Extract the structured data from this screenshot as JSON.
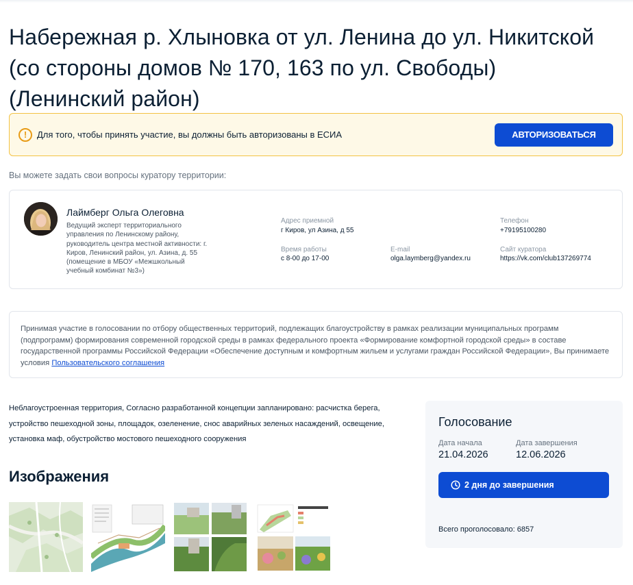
{
  "page": {
    "title": "Набережная р. Хлыновка от ул. Ленина до ул. Никитской (со стороны домов № 170, 163 по ул. Свободы) (Ленинский район)"
  },
  "alert": {
    "icon": "warning-icon",
    "text": "Для того, чтобы принять участие, вы должны быть авторизованы в ЕСИА",
    "button_label": "АВТОРИЗОВАТЬСЯ",
    "accent_color": "#f3c243",
    "button_color": "#0d4cd3"
  },
  "curator": {
    "intro": "Вы можете задать свои вопросы куратору территории:",
    "name": "Лаймберг Ольга Олеговна",
    "role": "Ведущий эксперт территориального управления по Ленинскому району, руководитель центра местной активности: г. Киров, Ленинский район, ул. Азина, д. 55 (помещение в МБОУ «Межшкольный учебный комбинат №3»)",
    "address_label": "Адрес приемной",
    "address": "г Киров, ул Азина, д 55",
    "hours_label": "Время работы",
    "hours": "с 8-00 до 17-00",
    "email_label": "E-mail",
    "email": "olga.laymberg@yandex.ru",
    "phone_label": "Телефон",
    "phone": "+79195100280",
    "site_label": "Сайт куратора",
    "site": "https://vk.com/club137269774"
  },
  "agreement": {
    "text": "Принимая участие в голосовании по отбору общественных территорий, подлежащих благоустройству в рамках реализации муниципальных программ (подпрограмм) формирования современной городской среды в рамках федерального проекта «Формирование комфортной городской среды» в составе государственной программы Российской Федерации «Обеспечение доступным и комфортным жильем и услугами граждан Российской Федерации», Вы принимаете условия",
    "link_label": "Пользовательского соглашения"
  },
  "description": "Неблагоустроенная территория, Согласно разработанной концепции запланировано: расчистка берега, устройство пешеходной зоны, площадок, озеленение, снос аварийных зеленых насаждений, освещение, установка маф, обустройство мостового пешеходного сооружения",
  "images": {
    "heading": "Изображения",
    "items": [
      "map-thumbnail",
      "plan-thumbnail",
      "photo-collage-thumbnail",
      "concept-thumbnail"
    ]
  },
  "voting": {
    "title": "Голосование",
    "start_label": "Дата начала",
    "start_date": "21.04.2026",
    "end_label": "Дата завершения",
    "end_date": "12.06.2026",
    "button_icon": "clock-icon",
    "button_label": "2 дня до завершения",
    "total_text": "Всего проголосовало: 6857"
  }
}
